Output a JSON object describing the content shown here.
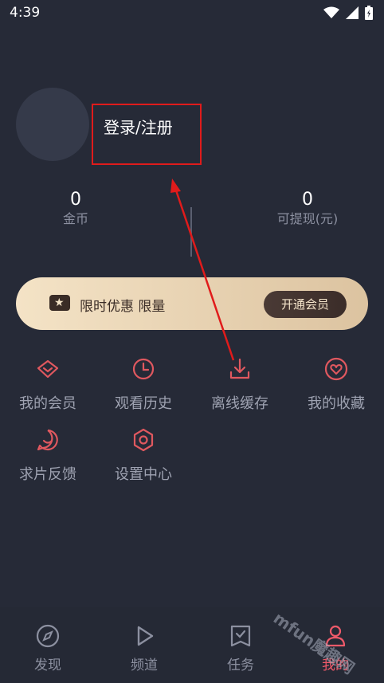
{
  "status_bar": {
    "time": "4:39"
  },
  "profile": {
    "login_label": "登录/注册"
  },
  "stats": [
    {
      "value": "0",
      "label": "金币"
    },
    {
      "value": "0",
      "label": "可提现(元)"
    }
  ],
  "vip_banner": {
    "text": "限时优惠 限量",
    "button_label": "开通会员"
  },
  "menu": [
    {
      "label": "我的会员",
      "icon": "diamond-icon"
    },
    {
      "label": "观看历史",
      "icon": "clock-icon"
    },
    {
      "label": "离线缓存",
      "icon": "download-icon"
    },
    {
      "label": "我的收藏",
      "icon": "heart-icon"
    },
    {
      "label": "求片反馈",
      "icon": "feedback-icon"
    },
    {
      "label": "设置中心",
      "icon": "settings-icon"
    }
  ],
  "tabs": [
    {
      "label": "发现",
      "icon": "compass-icon"
    },
    {
      "label": "频道",
      "icon": "play-icon"
    },
    {
      "label": "任务",
      "icon": "task-icon"
    },
    {
      "label": "我的",
      "icon": "user-icon",
      "active": true
    }
  ],
  "watermark": "mfun魔趣网",
  "colors": {
    "accent": "#ef5a6a",
    "icon_red": "#e0585f",
    "background": "#262a37",
    "annotation": "#e01b1b"
  }
}
